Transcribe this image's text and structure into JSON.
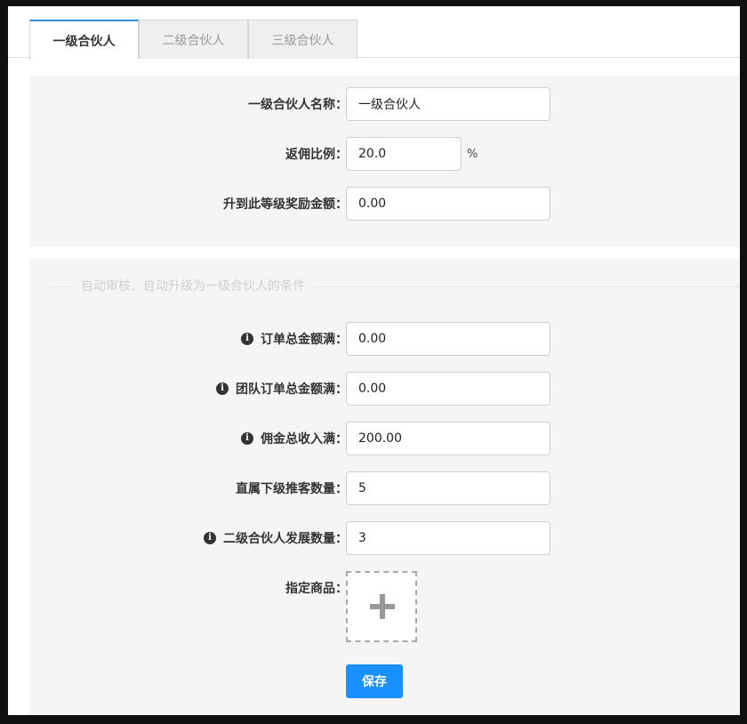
{
  "tabs": [
    {
      "label": "一级合伙人",
      "active": true
    },
    {
      "label": "二级合伙人",
      "active": false
    },
    {
      "label": "三级合伙人",
      "active": false
    }
  ],
  "basic": {
    "name_label": "一级合伙人名称：",
    "name_value": "一级合伙人",
    "rate_label": "返佣比例：",
    "rate_value": "20.0",
    "rate_unit": "%",
    "reward_label": "升到此等级奖励金额：",
    "reward_value": "0.00"
  },
  "conditions": {
    "section_title": "自动审核、自动升级为一级合伙人的条件",
    "order_total_label": "订单总金额满：",
    "order_total_value": "0.00",
    "team_order_total_label": "团队订单总金额满：",
    "team_order_total_value": "0.00",
    "commission_income_label": "佣金总收入满：",
    "commission_income_value": "200.00",
    "direct_referrals_label": "直属下级推客数量：",
    "direct_referrals_value": "5",
    "level2_count_label": "二级合伙人发展数量：",
    "level2_count_value": "3",
    "product_label": "指定商品："
  },
  "icons": {
    "info": "info-icon",
    "add": "plus-icon"
  },
  "actions": {
    "save_label": "保存"
  },
  "colors": {
    "accent": "#1890ff",
    "tab_active_border": "#2f8fdb"
  }
}
